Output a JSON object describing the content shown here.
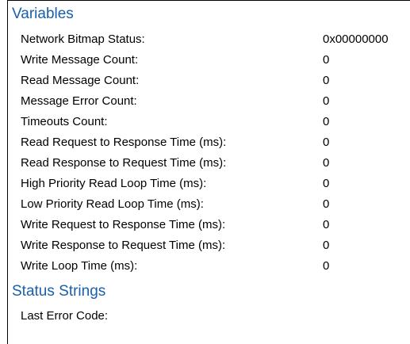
{
  "variables": {
    "heading": "Variables",
    "rows": [
      {
        "label": "Network Bitmap Status:",
        "value": "0x00000000"
      },
      {
        "label": "Write Message Count:",
        "value": "0"
      },
      {
        "label": "Read Message Count:",
        "value": "0"
      },
      {
        "label": "Message Error Count:",
        "value": "0"
      },
      {
        "label": "Timeouts Count:",
        "value": "0"
      },
      {
        "label": "Read Request to Response Time (ms):",
        "value": "0"
      },
      {
        "label": "Read Response to Request Time (ms):",
        "value": "0"
      },
      {
        "label": "High Priority Read Loop Time (ms):",
        "value": "0"
      },
      {
        "label": "Low Priority Read Loop Time (ms):",
        "value": "0"
      },
      {
        "label": "Write Request to Response Time (ms):",
        "value": "0"
      },
      {
        "label": "Write Response to Request Time (ms):",
        "value": "0"
      },
      {
        "label": "Write Loop Time (ms):",
        "value": "0"
      }
    ]
  },
  "status_strings": {
    "heading": "Status Strings",
    "rows": [
      {
        "label": "Last Error Code:",
        "value": ""
      }
    ]
  }
}
